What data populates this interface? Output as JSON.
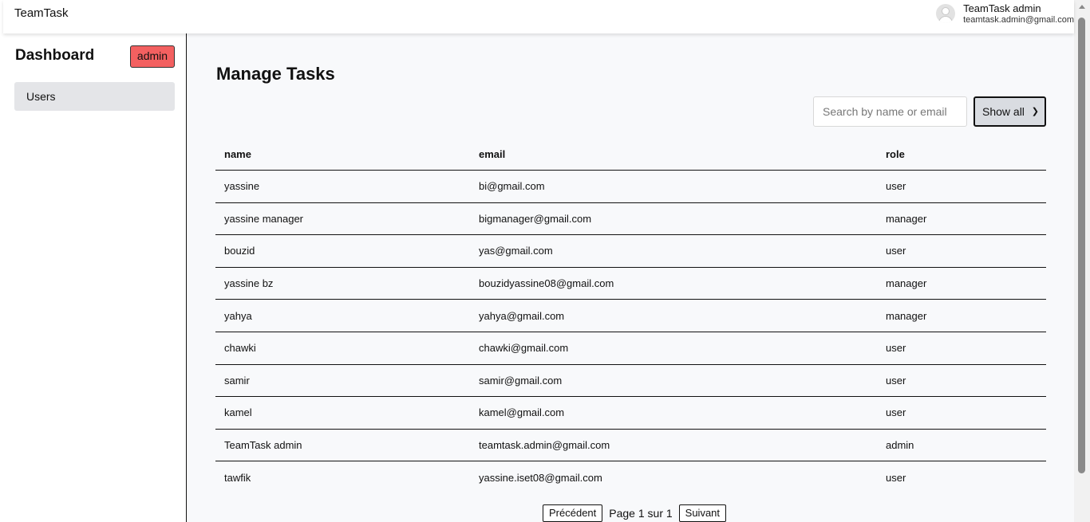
{
  "topbar": {
    "brand": "TeamTask",
    "user_name": "TeamTask admin",
    "user_email": "teamtask.admin@gmail.com",
    "avatar_icon": "user-avatar-icon"
  },
  "sidebar": {
    "title": "Dashboard",
    "badge": "admin",
    "badge_color": "#f36060",
    "items": [
      {
        "label": "Users"
      }
    ]
  },
  "main": {
    "title": "Manage Tasks",
    "search_placeholder": "Search by name or email",
    "filter_selected": "Show all",
    "columns": [
      "name",
      "email",
      "role"
    ],
    "rows": [
      {
        "name": "yassine",
        "email": "bi@gmail.com",
        "role": "user"
      },
      {
        "name": "yassine manager",
        "email": "bigmanager@gmail.com",
        "role": "manager"
      },
      {
        "name": "bouzid",
        "email": "yas@gmail.com",
        "role": "user"
      },
      {
        "name": "yassine bz",
        "email": "bouzidyassine08@gmail.com",
        "role": "manager"
      },
      {
        "name": "yahya",
        "email": "yahya@gmail.com",
        "role": "manager"
      },
      {
        "name": "chawki",
        "email": "chawki@gmail.com",
        "role": "user"
      },
      {
        "name": "samir",
        "email": "samir@gmail.com",
        "role": "user"
      },
      {
        "name": "kamel",
        "email": "kamel@gmail.com",
        "role": "user"
      },
      {
        "name": "TeamTask admin",
        "email": "teamtask.admin@gmail.com",
        "role": "admin"
      },
      {
        "name": "tawfik",
        "email": "yassine.iset08@gmail.com",
        "role": "user"
      }
    ],
    "pagination": {
      "prev": "Précédent",
      "info": "Page 1 sur 1",
      "next": "Suivant"
    }
  }
}
